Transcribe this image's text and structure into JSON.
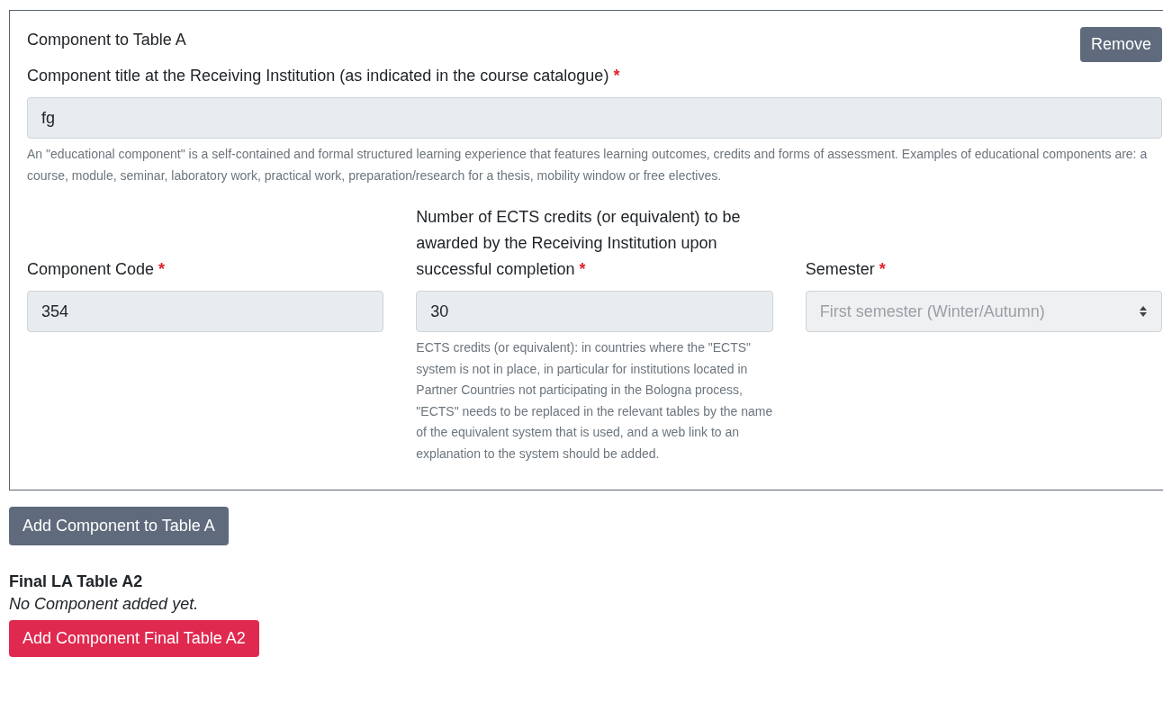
{
  "component_card": {
    "title": "Component to Table A",
    "remove_button": "Remove",
    "title_field": {
      "label": "Component title at the Receiving Institution (as indicated in the course catalogue)",
      "required_mark": "*",
      "value": "fg",
      "help": "An \"educational component\" is a self-contained and formal structured learning experience that features learning outcomes, credits and forms of assessment. Examples of educational components are: a course, module, seminar, laboratory work, practical work, preparation/research for a thesis, mobility window or free electives."
    },
    "fields": [
      {
        "kind": "input",
        "label": "Component Code",
        "required_mark": "*",
        "value": "354",
        "disabled": false
      },
      {
        "kind": "input",
        "label": "Number of ECTS credits (or equivalent) to be awarded by the Receiving Institution upon successful completion",
        "required_mark": "*",
        "value": "30",
        "disabled": false,
        "help": "ECTS credits (or equivalent): in countries where the \"ECTS\" system is not in place, in particular for institutions located in Partner Countries not participating in the Bologna process, \"ECTS\" needs to be replaced in the relevant tables by the name of the equivalent system that is used, and a web link to an explanation to the system should be added."
      },
      {
        "kind": "select",
        "label": "Semester",
        "required_mark": "*",
        "value": "First semester (Winter/Autumn)",
        "disabled": true
      }
    ]
  },
  "add_table_a_button": "Add Component to Table A",
  "final_table": {
    "heading": "Final LA Table A2",
    "empty_note": "No Component added yet.",
    "add_button": "Add Component Final Table A2"
  }
}
